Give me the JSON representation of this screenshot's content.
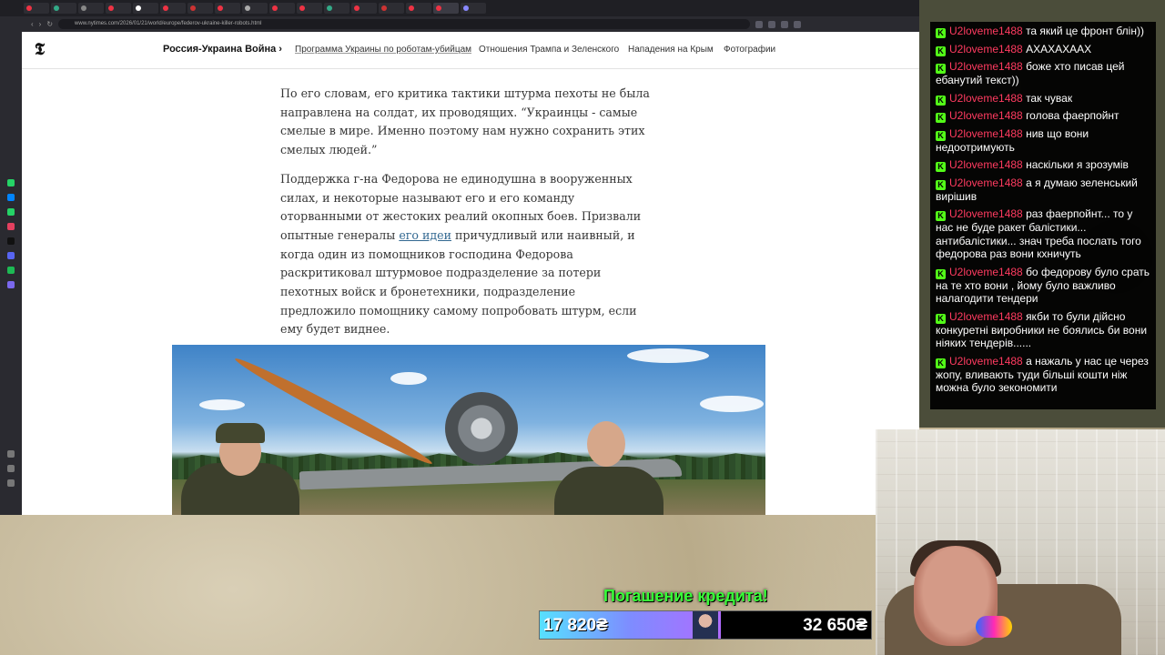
{
  "browser": {
    "url": "www.nytimes.com/2026/01/21/world/europe/federov-ukraine-killer-robots.html",
    "tabs": [
      "",
      "",
      "",
      "",
      "",
      "",
      "",
      "",
      "",
      "",
      "",
      "",
      "",
      "",
      "",
      "",
      ""
    ]
  },
  "nyt": {
    "logo": "𝕿",
    "section": "Россия-Украина Война ›",
    "links": [
      "Программа Украины по роботам-убийцам",
      "Отношения Трампа и Зеленского",
      "Нападения на Крым",
      "Фотографии"
    ]
  },
  "article": {
    "p1": "По его словам, его критика тактики штурма пехоты не была направлена на солдат, их проводящих. “Украинцы - самые смелые в мире. Именно поэтому нам нужно сохранить этих смелых людей.”",
    "p2_before": "Поддержка г-на Федорова не единодушна в вооруженных силах, и некоторые называют его и его команду оторванными от жестоких реалий окопных боев. Призвали опытные генералы ",
    "p2_link": "его идеи",
    "p2_after": " причудливый или наивный, и когда один из помощников господина Федорова раскритиковал штурмовое подразделение за потери пехотных войск и бронетехники, подразделение предложило помощнику самому попробовать штурм, если ему будет виднее."
  },
  "chat": {
    "badge": "K",
    "messages": [
      {
        "user": "U2loveme1488",
        "text": "та який це фронт блін))"
      },
      {
        "user": "U2loveme1488",
        "text": "АХАХАХААХ"
      },
      {
        "user": "U2loveme1488",
        "text": "боже хто писав цей ебанутий текст))"
      },
      {
        "user": "U2loveme1488",
        "text": "так чувак"
      },
      {
        "user": "U2loveme1488",
        "text": "голова фаерпойнт"
      },
      {
        "user": "U2loveme1488",
        "text": "нив що вони недоотримують"
      },
      {
        "user": "U2loveme1488",
        "text": "наскільки я зрозумів"
      },
      {
        "user": "U2loveme1488",
        "text": "а я думаю зеленський вирішив"
      },
      {
        "user": "U2loveme1488",
        "text": "раз фаерпойнт... то у нас не буде ракет балістики... антибалістики... знач треба послать того федорова раз вони кхничуть"
      },
      {
        "user": "U2loveme1488",
        "text": "бо федорову було срать на те хто вони , йому було важливо налагодити тендери"
      },
      {
        "user": "U2loveme1488",
        "text": "якби то були дійсно конкуретні виробники не боялись би вони ніяких тендерів......"
      },
      {
        "user": "U2loveme1488",
        "text": "а нажаль у нас це через жопу, вливають туди більші кошти ніж можна було зекономити"
      }
    ]
  },
  "goal": {
    "title": "Погашение кредита!",
    "current": "17 820₴",
    "target": "32 650₴",
    "progress": 0.546
  },
  "colors": {
    "chat_user": "#ff3b60",
    "chat_badge": "#53fc18",
    "goal_title": "#38ff38",
    "link": "#326891"
  }
}
